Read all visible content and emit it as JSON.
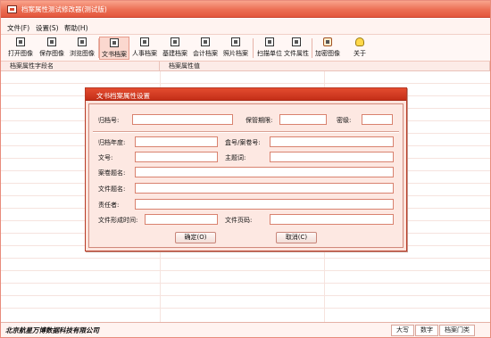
{
  "window": {
    "title": "档案属性测试修改器(测试版)"
  },
  "menu": {
    "items": [
      "文件(F)",
      "设置(S)",
      "帮助(H)"
    ]
  },
  "toolbar": {
    "buttons": [
      "打开图像",
      "保存图像",
      "浏览图像",
      "文书档案",
      "人事档案",
      "基建档案",
      "会计档案",
      "照片档案",
      "扫描单位",
      "文件属性",
      "加密图像",
      "关于"
    ],
    "active": "文书档案"
  },
  "grid": {
    "columns": [
      "档案属性字段名",
      "档案属性值"
    ]
  },
  "dialog": {
    "title": "文书档案属性设置",
    "fields": {
      "archive_no": {
        "label": "归档号:",
        "value": ""
      },
      "retention": {
        "label": "保管期限:",
        "value": ""
      },
      "secrecy": {
        "label": "密级:",
        "value": ""
      },
      "archive_year": {
        "label": "归档年度:",
        "value": ""
      },
      "box_no": {
        "label": "盒号/案卷号:",
        "value": ""
      },
      "doc_no": {
        "label": "文号:",
        "value": ""
      },
      "subject": {
        "label": "主题词:",
        "value": ""
      },
      "volume_name": {
        "label": "案卷题名:",
        "value": ""
      },
      "file_name": {
        "label": "文件题名:",
        "value": ""
      },
      "responsible": {
        "label": "责任者:",
        "value": ""
      },
      "date_formed": {
        "label": "文件形成时间:",
        "value": ""
      },
      "page_no": {
        "label": "文件页码:",
        "value": ""
      }
    },
    "ok_label": "确定(O)",
    "cancel_label": "取消(C)"
  },
  "status": {
    "company": "北京航星万博数据科技有限公司",
    "cells": [
      "大写",
      "数字",
      "档案门类"
    ]
  },
  "colors": {
    "accent": "#e4563c",
    "dialog_title": "#c42f18",
    "dialog_bg": "#fde4dd",
    "field_border": "#d9826f"
  }
}
